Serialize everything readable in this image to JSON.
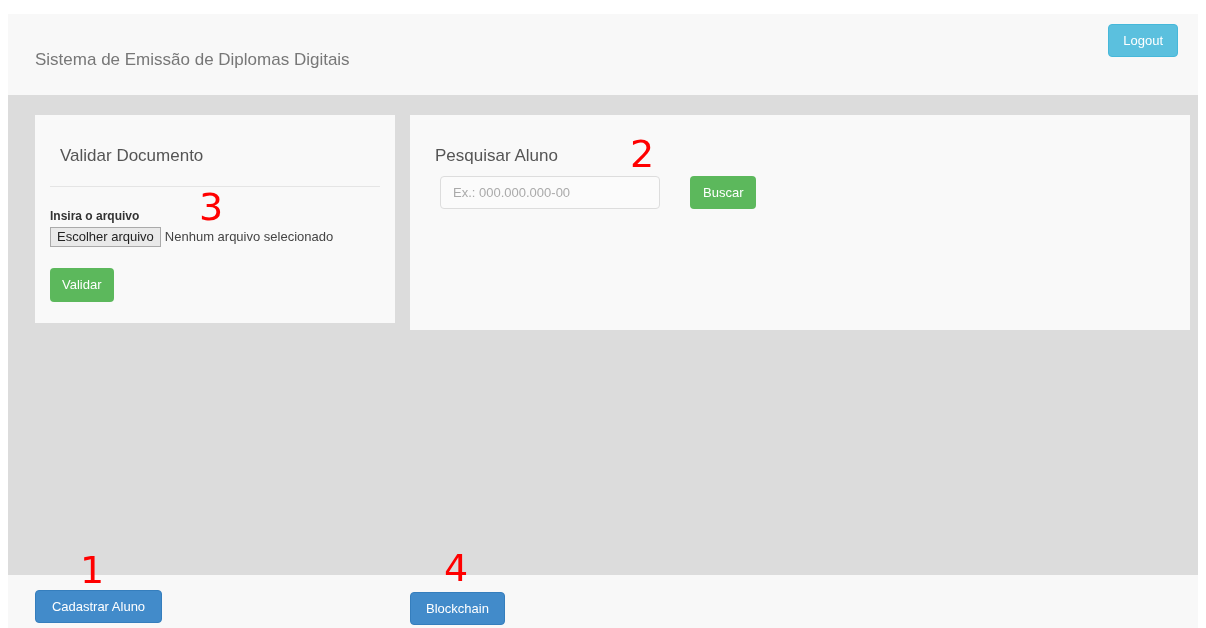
{
  "header": {
    "title": "Sistema de Emissão de Diplomas Digitais",
    "logout_button": "Logout"
  },
  "validate_panel": {
    "title": "Validar Documento",
    "file_label": "Insira o arquivo",
    "file_button": "Escolher arquivo",
    "file_status": "Nenhum arquivo selecionado",
    "submit_button": "Validar"
  },
  "search_panel": {
    "title": "Pesquisar Aluno",
    "placeholder": "Ex.: 000.000.000-00",
    "submit_button": "Buscar"
  },
  "footer": {
    "buttons": [
      "Cadastrar Aluno",
      "Blockchain"
    ]
  },
  "annotations": [
    "1",
    "2",
    "3",
    "4"
  ]
}
